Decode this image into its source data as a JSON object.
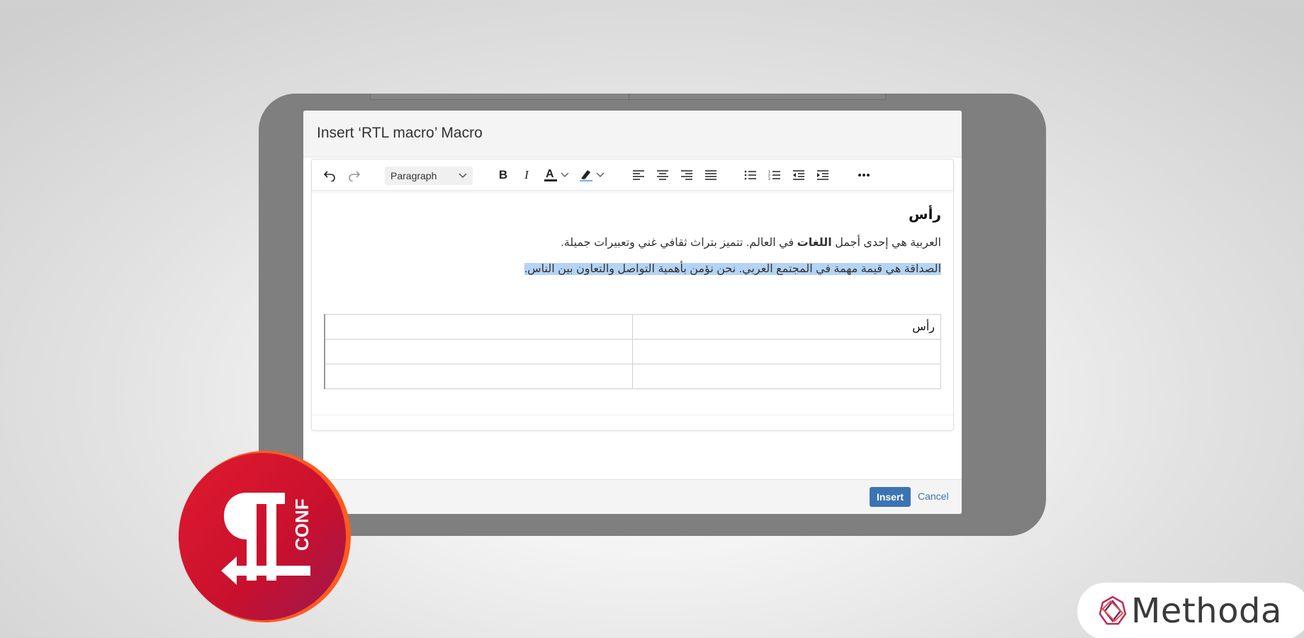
{
  "dialog": {
    "title": "Insert ‘RTL macro’ Macro",
    "insert_label": "Insert",
    "cancel_label": "Cancel"
  },
  "toolbar": {
    "paragraph_select": "Paragraph",
    "icons": [
      "undo-icon",
      "redo-icon",
      "bold-icon",
      "italic-icon",
      "text-color-icon",
      "highlight-icon",
      "align-left-icon",
      "align-center-icon",
      "align-right-icon",
      "align-justify-icon",
      "bullet-list-icon",
      "numbered-list-icon",
      "outdent-icon",
      "indent-icon",
      "more-icon"
    ]
  },
  "content": {
    "heading": "رأس",
    "para1_before": "العربية هي إحدى أجمل ",
    "para1_bold": "اللغات",
    "para1_after": " في العالم. تتميز بتراث ثقافي غني وتعبيرات جميلة.",
    "para2": "الصداقة هي قيمة مهمة في المجتمع العربي. نحن نؤمن بأهمية التواصل والتعاون بين الناس.",
    "table_rows": [
      [
        "رأس",
        ""
      ],
      [
        "",
        ""
      ],
      [
        "",
        ""
      ]
    ]
  },
  "branding": {
    "logo_text": "CONF",
    "company": "Methoda"
  },
  "colors": {
    "primary_button": "#3b73b4",
    "selection": "#b4d3f5",
    "logo_red": "#c8102e"
  }
}
